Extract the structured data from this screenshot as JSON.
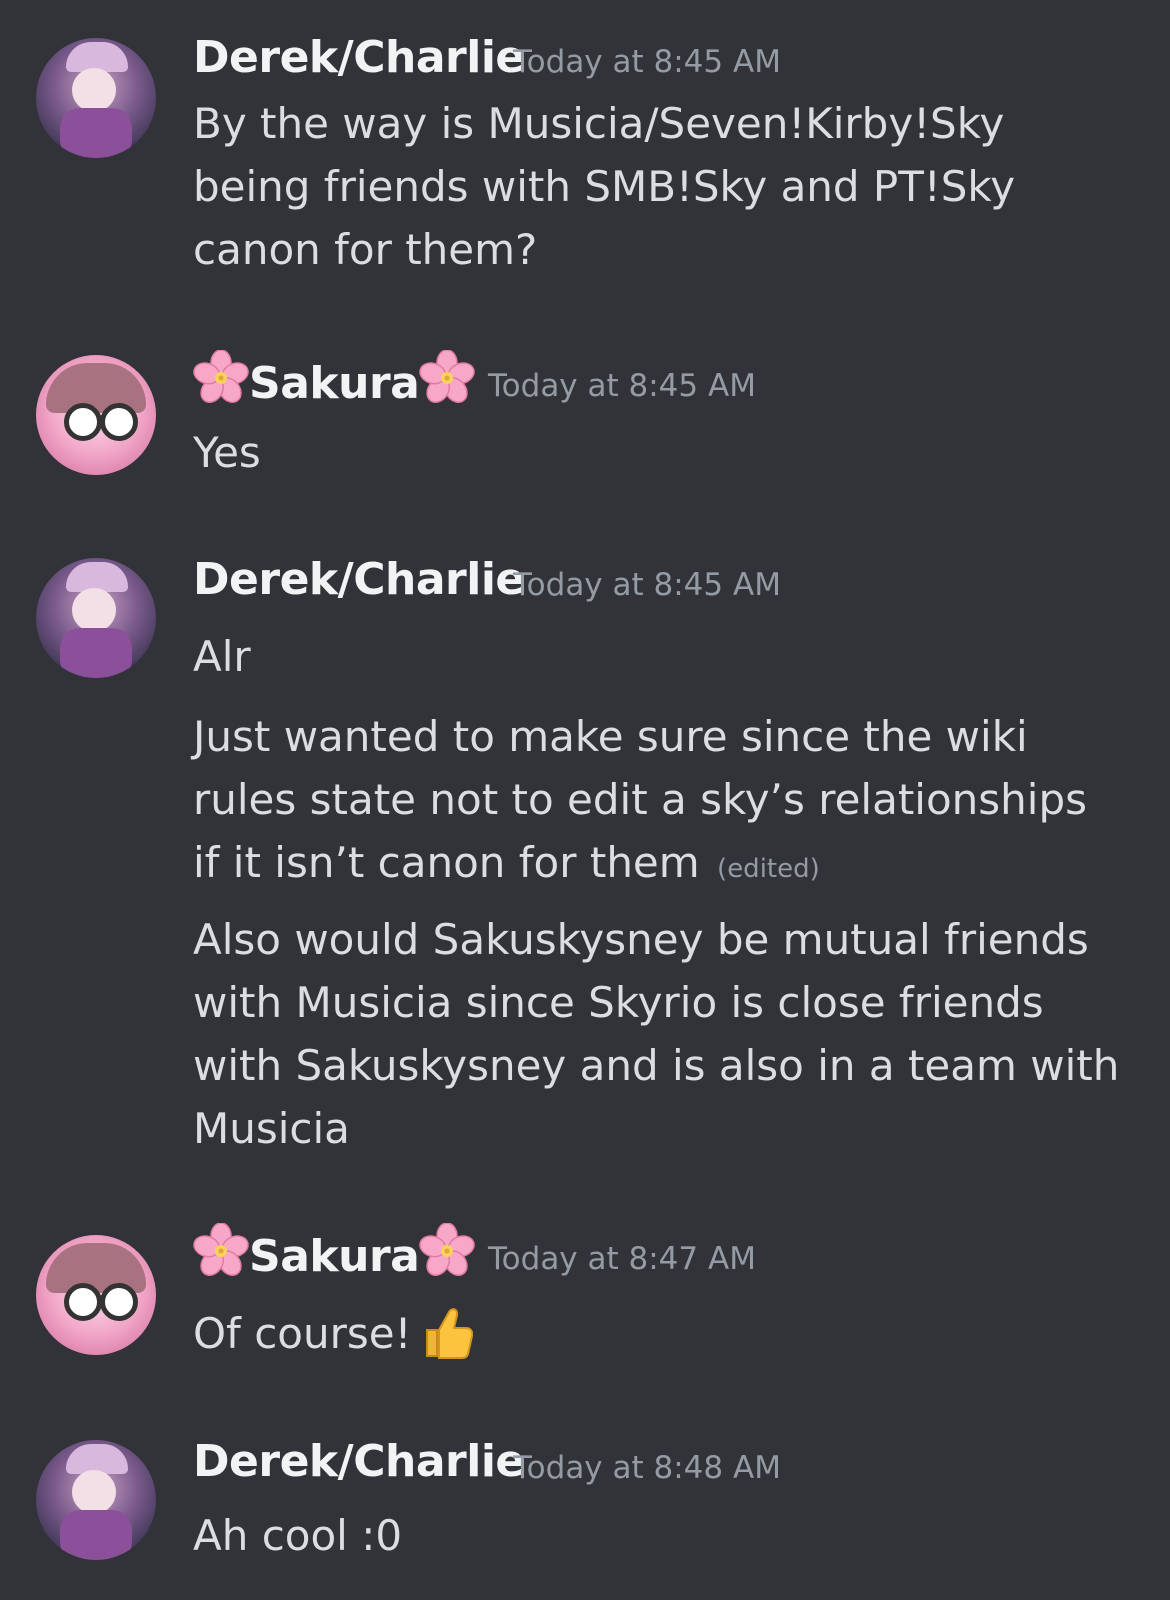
{
  "messages": [
    {
      "author": "Derek/Charlie",
      "timestamp": "Today at 8:45 AM",
      "lines": [
        "By the way is Musicia/Seven!Kirby!Sky being friends with SMB!Sky and PT!Sky canon for them?"
      ]
    },
    {
      "author": "Sakura",
      "timestamp": "Today at 8:45 AM",
      "lines": [
        "Yes"
      ]
    },
    {
      "author": "Derek/Charlie",
      "timestamp": "Today at 8:45 AM",
      "lines": [
        "Alr",
        "Just wanted to make sure since the wiki rules state not to edit a sky’s relationships if it isn’t canon for them",
        "Also would Sakuskysney be mutual friends with Musicia since Skyrio is close friends with Sakuskysney and is also in a team with Musicia"
      ],
      "edited_label": "(edited)"
    },
    {
      "author": "Sakura",
      "timestamp": "Today at 8:47 AM",
      "lines": [
        "Of course!"
      ],
      "emoji": "thumbs-up"
    },
    {
      "author": "Derek/Charlie",
      "timestamp": "Today at 8:48 AM",
      "lines": [
        "Ah cool :0"
      ]
    }
  ],
  "name_decoration_icon": "cherry-blossom-icon",
  "colors": {
    "background": "#313338",
    "username": "#f2f3f5",
    "message_text": "#dbdee1",
    "timestamp": "#949ba4"
  }
}
